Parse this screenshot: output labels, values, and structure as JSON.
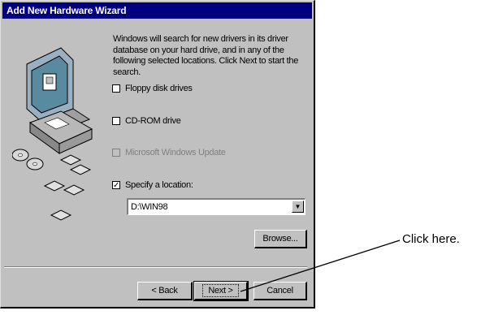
{
  "window": {
    "title": "Add New Hardware Wizard"
  },
  "description": "Windows will search for new drivers in its driver database on your hard drive, and in any of the following selected locations. Click Next to start the search.",
  "options": [
    {
      "label": "Floppy disk drives",
      "checked": false,
      "enabled": true
    },
    {
      "label": "CD-ROM drive",
      "checked": false,
      "enabled": true
    },
    {
      "label": "Microsoft Windows Update",
      "checked": false,
      "enabled": false
    },
    {
      "label": "Specify a location:",
      "checked": true,
      "enabled": true
    }
  ],
  "location": {
    "value": "D:\\WIN98"
  },
  "buttons": {
    "browse": "Browse...",
    "back": "< Back",
    "next": "Next >",
    "cancel": "Cancel"
  },
  "callout": "Click here."
}
